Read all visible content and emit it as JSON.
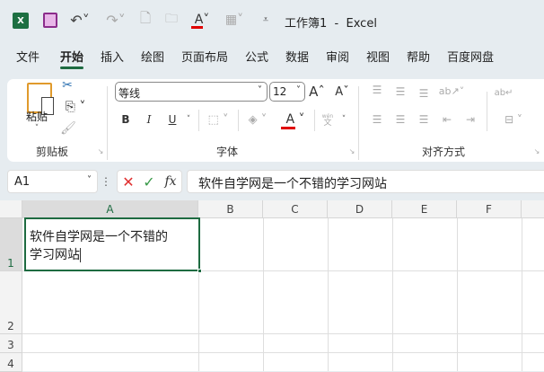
{
  "title": "工作簿1  -  Excel",
  "tabs": [
    "文件",
    "开始",
    "插入",
    "绘图",
    "页面布局",
    "公式",
    "数据",
    "审阅",
    "视图",
    "帮助",
    "百度网盘"
  ],
  "clipboard": {
    "paste": "粘贴",
    "group": "剪贴板"
  },
  "font": {
    "name": "等线",
    "size": "12",
    "bold": "B",
    "italic": "I",
    "underline": "U",
    "group": "字体",
    "wen_top": "wén",
    "wen": "文"
  },
  "align": {
    "group": "对齐方式"
  },
  "formula_bar": {
    "name_box": "A1",
    "fx": "fx",
    "content": "软件自学网是一个不错的学习网站"
  },
  "columns": [
    "A",
    "B",
    "C",
    "D",
    "E",
    "F"
  ],
  "rows": [
    "1",
    "2",
    "3",
    "4"
  ],
  "cell_a1": {
    "line1": "软件自学网是一个不错的",
    "line2": "学习网站"
  },
  "colors": {
    "accent": "#1e6b41",
    "font_color": "#e00000"
  }
}
